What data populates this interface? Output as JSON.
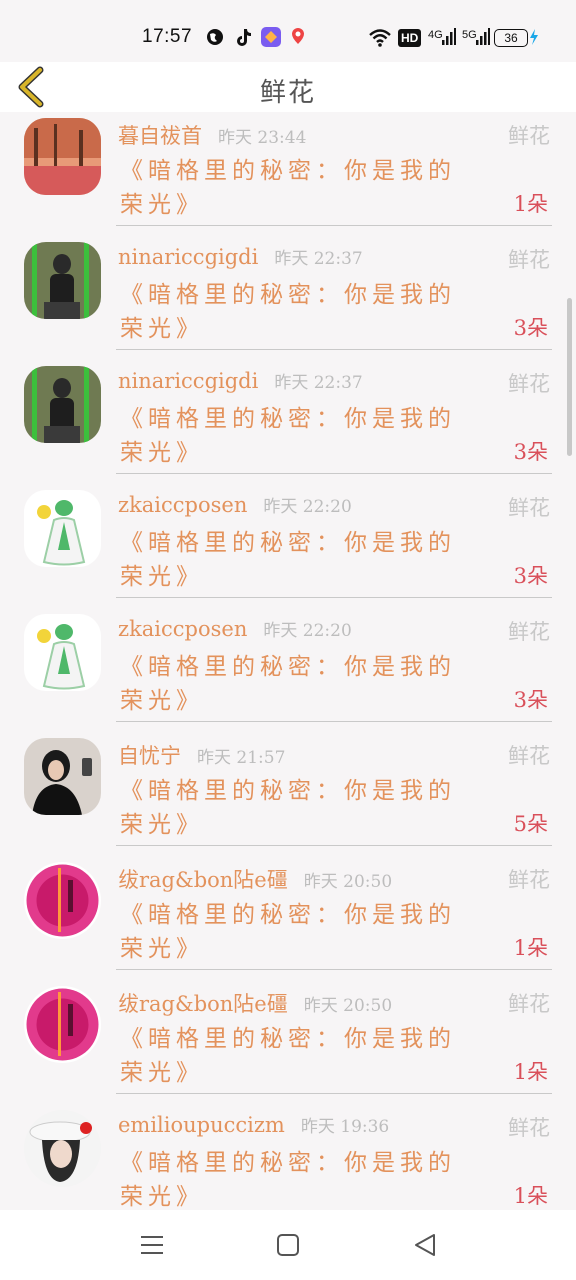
{
  "status_bar": {
    "time": "17:57",
    "network_label": "HD",
    "net4g": "4G",
    "net5g": "5G",
    "battery": "36"
  },
  "header": {
    "title": "鲜花"
  },
  "rows": [
    {
      "name": "暮自祓首",
      "time": "昨天 23:44",
      "tag": "鲜花",
      "message": "《暗格里的秘密：你是我的荣光》",
      "count": "1朵",
      "avatar": "autumn-park"
    },
    {
      "name": "ninariccgigdi",
      "time": "昨天 22:37",
      "tag": "鲜花",
      "message": "《暗格里的秘密：你是我的荣光》",
      "count": "3朵",
      "avatar": "rocker"
    },
    {
      "name": "ninariccgigdi",
      "time": "昨天 22:37",
      "tag": "鲜花",
      "message": "《暗格里的秘密：你是我的荣光》",
      "count": "3朵",
      "avatar": "rocker"
    },
    {
      "name": "zkaiccposen",
      "time": "昨天 22:20",
      "tag": "鲜花",
      "message": "《暗格里的秘密：你是我的荣光》",
      "count": "3朵",
      "avatar": "green-fairy"
    },
    {
      "name": "zkaiccposen",
      "time": "昨天 22:20",
      "tag": "鲜花",
      "message": "《暗格里的秘密：你是我的荣光》",
      "count": "3朵",
      "avatar": "green-fairy"
    },
    {
      "name": "自忧宁",
      "time": "昨天 21:57",
      "tag": "鲜花",
      "message": "《暗格里的秘密：你是我的荣光》",
      "count": "5朵",
      "avatar": "girl-dark"
    },
    {
      "name": "绂rag&bon阽e礓",
      "time": "昨天 20:50",
      "tag": "鲜花",
      "message": "《暗格里的秘密：你是我的荣光》",
      "count": "1朵",
      "avatar": "neon-pink"
    },
    {
      "name": "绂rag&bon阽e礓",
      "time": "昨天 20:50",
      "tag": "鲜花",
      "message": "《暗格里的秘密：你是我的荣光》",
      "count": "1朵",
      "avatar": "neon-pink"
    },
    {
      "name": "emilioupuccizm",
      "time": "昨天 19:36",
      "tag": "鲜花",
      "message": "《暗格里的秘密：你是我的荣光》",
      "count": "1朵",
      "avatar": "hat-girl"
    }
  ],
  "colors": {
    "accent": "#e3925c",
    "count": "#d9505a",
    "muted": "#bdbdbd",
    "back_icon": "#d8b52a"
  },
  "icons": {
    "back": "chevron-left-icon",
    "nav_menu": "menu-icon",
    "nav_home": "square-home-icon",
    "nav_back": "triangle-back-icon"
  }
}
